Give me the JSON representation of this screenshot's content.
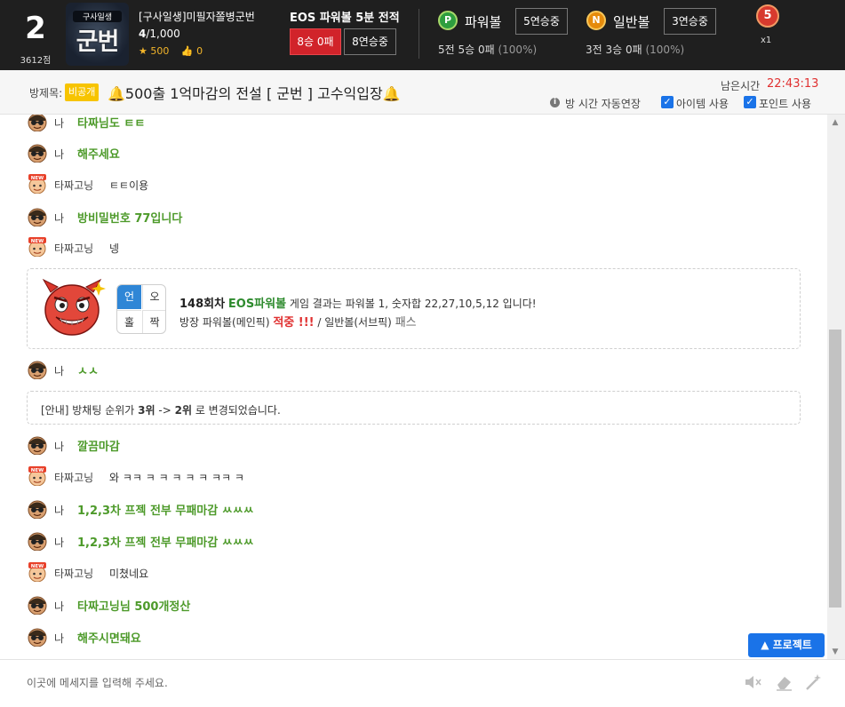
{
  "header": {
    "rank": "2",
    "points": "3612점",
    "logo": {
      "top_text": "구사일생",
      "main_text": "군번"
    },
    "room_name": "[구사일생]미필자쫄병군번",
    "member_current": "4",
    "member_max": "/1,000",
    "stars": "500",
    "likes": "0",
    "eos_title": "EOS 파워볼 5분 전적",
    "win_loss": "8승 0패",
    "streak_overall": "8연승중",
    "powerball": {
      "ball": "P",
      "label": "파워볼",
      "streak": "5연승중",
      "record": "5전 5승 0패",
      "pct": "(100%)"
    },
    "normalball": {
      "ball": "N",
      "label": "일반볼",
      "streak": "3연승중",
      "record": "3전 3승 0패",
      "pct": "(100%)"
    },
    "badge": {
      "value": "5",
      "multiplier": "x1"
    },
    "colors": {
      "background": "#1f1f1f",
      "win_red": "#d1232a",
      "powerball_green": "#2e9e3f",
      "normalball_orange": "#e58b0c"
    }
  },
  "title_bar": {
    "label": "방제목:",
    "private_badge": "비공개",
    "title": "500출 1억마감의 전설 [ 군번 ] 고수익입장",
    "remaining_label": "남은시간",
    "remaining_time": "22:43:13",
    "auto_extend": "방 시간 자동연장",
    "item_use": "아이템 사용",
    "point_use": "포인트 사용"
  },
  "messages": [
    {
      "type": "me",
      "nick": "나",
      "text": "타짜님도 ㅌㅌ"
    },
    {
      "type": "me",
      "nick": "나",
      "text": "해주세요"
    },
    {
      "type": "other",
      "nick": "타짜고닝",
      "text": "ㅌㅌ이용"
    },
    {
      "type": "me",
      "nick": "나",
      "text": "방비밀번호 77입니다"
    },
    {
      "type": "other",
      "nick": "타짜고닝",
      "text": "넹"
    },
    {
      "type": "me",
      "nick": "나",
      "text": "ㅅㅅ"
    },
    {
      "type": "me",
      "nick": "나",
      "text": "깔끔마감"
    },
    {
      "type": "other",
      "nick": "타짜고닝",
      "text": "와 ㅋㅋ ㅋ ㅋ ㅋ ㅋ ㅋ ㅋㅋ ㅋ"
    },
    {
      "type": "me",
      "nick": "나",
      "text": "1,2,3차 프젝 전부 무패마감 ㅆㅆㅆ"
    },
    {
      "type": "me",
      "nick": "나",
      "text": "1,2,3차 프젝 전부 무패마감 ㅆㅆㅆ"
    },
    {
      "type": "other",
      "nick": "타짜고닝",
      "text": "미쳤네요"
    },
    {
      "type": "me",
      "nick": "나",
      "text": "타짜고닝님 500개정산"
    },
    {
      "type": "me",
      "nick": "나",
      "text": "해주시면돼요"
    }
  ],
  "result_card": {
    "grid": {
      "tl": "언",
      "tr": "오",
      "bl": "홀",
      "br": "짝"
    },
    "round": "148회차",
    "game": "EOS파워볼",
    "line1_rest": "게임 결과는 파워볼 1, 숫자합 22,27,10,5,12 입니다!",
    "line2_prefix": "방장 파워볼(메인픽)",
    "hit": "적중 !!!",
    "line2_mid": "/ 일반볼(서브픽)",
    "pass": "패스"
  },
  "notice": {
    "prefix": "[안내] 방채팅 순위가",
    "from": "3위",
    "arrow": "->",
    "to": "2위",
    "suffix": "로 변경되었습니다."
  },
  "project_button": "프로젝트",
  "input": {
    "placeholder": "이곳에 메세지를 입력해 주세요."
  },
  "colors": {
    "accent_blue": "#1a73e8",
    "my_text_green": "#4d9a2a",
    "alert_red": "#e03131"
  }
}
